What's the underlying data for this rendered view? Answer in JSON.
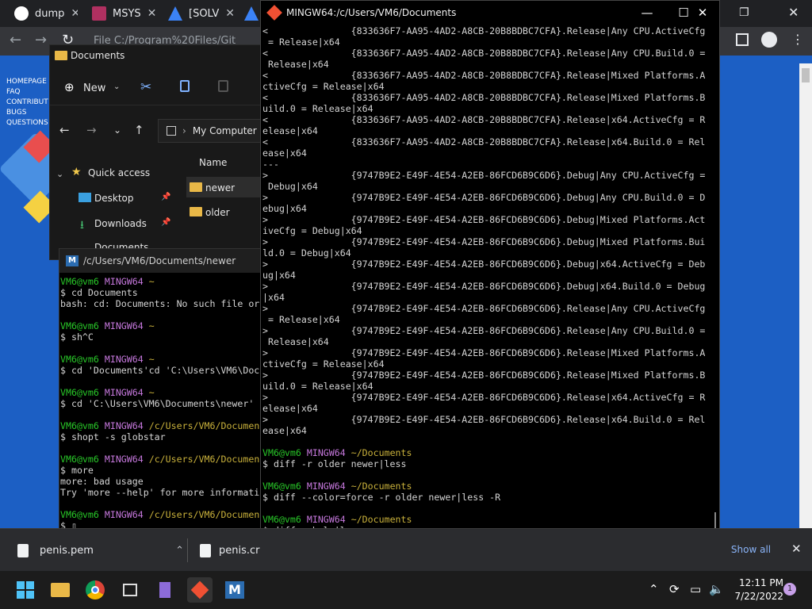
{
  "browser": {
    "tabs": [
      {
        "label": "dump",
        "color": "#ffffff"
      },
      {
        "label": "MSYS",
        "color": "#b03060"
      },
      {
        "label": "[SOLV",
        "color": "#3b82f6"
      },
      {
        "label": "",
        "color": "#3b82f6"
      }
    ],
    "address": "File   C:/Program%20Files/Git",
    "page_links": [
      "HOMEPAGE",
      "FAQ",
      "CONTRIBUT",
      "BUGS",
      "QUESTIONS"
    ]
  },
  "explorer": {
    "title": "Documents",
    "new_label": "New",
    "breadcrumb": "My Computer",
    "column_name": "Name",
    "nav": [
      {
        "label": "Quick access"
      },
      {
        "label": "Desktop"
      },
      {
        "label": "Downloads"
      },
      {
        "label": "Documents"
      }
    ],
    "files": [
      "newer",
      "older"
    ]
  },
  "msys": {
    "title": "/c/Users/VM6/Documents/newer"
  },
  "mingw": {
    "title": "MINGW64:/c/Users/VM6/Documents"
  },
  "downloads": {
    "items": [
      "penis.pem",
      "penis.cr"
    ],
    "show_all": "Show all"
  },
  "taskbar": {
    "time": "12:11 PM",
    "date": "7/22/2022",
    "notifications": "1"
  },
  "colors": {
    "prompt_user": "#28c728",
    "prompt_host": "#c678dd",
    "prompt_path": "#c9b13b"
  }
}
